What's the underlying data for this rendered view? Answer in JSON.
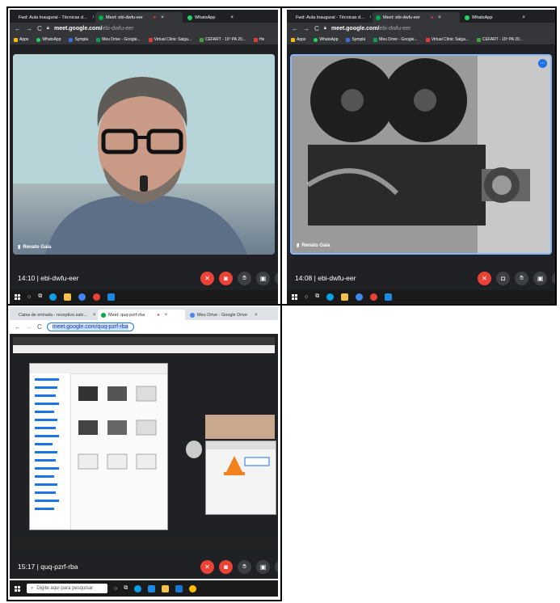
{
  "cells": {
    "c1": {
      "tabs": [
        {
          "label": "Fwd: Aula Inaugural - Técnicas d…",
          "x": "×"
        },
        {
          "label": "Meet: ebi-dwfu-eer",
          "x": "×"
        },
        {
          "label": "WhatsApp",
          "x": "×"
        }
      ],
      "url_prefix": "meet.google.com/",
      "url_rest": "ebi-dwfu-eer",
      "bookmarks": [
        "Apps",
        "WhatsApp",
        "Sympla",
        "Meu Drive - Google...",
        "Virtual Clínic Salga...",
        "CEFART - 10º PA 20...",
        "He"
      ],
      "participant": "Renato Gaia",
      "time": "14:10",
      "code": "ebi-dwfu-eer"
    },
    "c2": {
      "tabs": [
        {
          "label": "Fwd: Aula Inaugural - Técnicas d…",
          "x": "×"
        },
        {
          "label": "Meet: ebi-dwfu-eer",
          "x": "×"
        },
        {
          "label": "WhatsApp",
          "x": "×"
        }
      ],
      "url_prefix": "meet.google.com/",
      "url_rest": "ebi-dwfu-eer",
      "bookmarks": [
        "Apps",
        "WhatsApp",
        "Sympla",
        "Meu Drive - Google...",
        "Virtual Clínic Salga...",
        "CEFART - 10º PA 20..."
      ],
      "participant": "Renato Gaia",
      "time": "14:08",
      "code": "ebi-dwfu-eer"
    },
    "c3": {
      "tabs": [
        {
          "label": "Caixa de entrada - receptivo.salv…",
          "x": "×"
        },
        {
          "label": "Meet: quq-pzrf-rba",
          "x": "×"
        },
        {
          "label": "Meu Drive - Google Drive",
          "x": "×"
        }
      ],
      "url": "meet.google.com/quq-pzrf-rba",
      "time": "15:17",
      "code": "quq-pzrf-rba",
      "search_placeholder": "Digite aqui para pesquisar"
    }
  },
  "colors": {
    "meet_bg": "#202124",
    "chrome_dark": "#35363a",
    "end_red": "#ea4335"
  }
}
